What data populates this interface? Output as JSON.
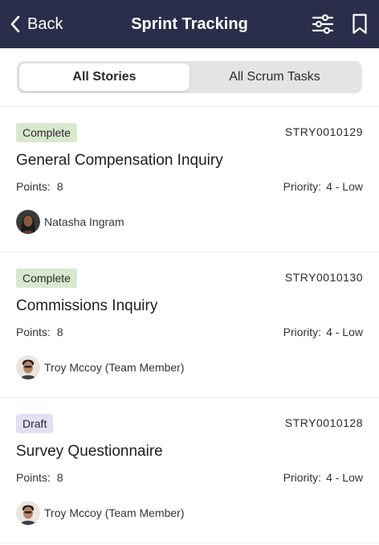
{
  "header": {
    "back_label": "Back",
    "title": "Sprint Tracking",
    "background": "#2b2e4a"
  },
  "tabs": [
    {
      "label": "All Stories",
      "active": true
    },
    {
      "label": "All Scrum Tasks",
      "active": false
    }
  ],
  "stories": [
    {
      "status": "Complete",
      "status_color": "#d8e8cf",
      "id": "STRY0010129",
      "title": "General Compensation Inquiry",
      "points_label": "Points:",
      "points": "8",
      "priority_label": "Priority:",
      "priority": "4 - Low",
      "assignee": "Natasha Ingram"
    },
    {
      "status": "Complete",
      "status_color": "#d8e8cf",
      "id": "STRY0010130",
      "title": "Commissions Inquiry",
      "points_label": "Points:",
      "points": "8",
      "priority_label": "Priority:",
      "priority": "4 - Low",
      "assignee": "Troy Mccoy (Team Member)"
    },
    {
      "status": "Draft",
      "status_color": "#e3dff6",
      "id": "STRY0010128",
      "title": "Survey Questionnaire",
      "points_label": "Points:",
      "points": "8",
      "priority_label": "Priority:",
      "priority": "4 - Low",
      "assignee": "Troy Mccoy (Team Member)"
    }
  ]
}
